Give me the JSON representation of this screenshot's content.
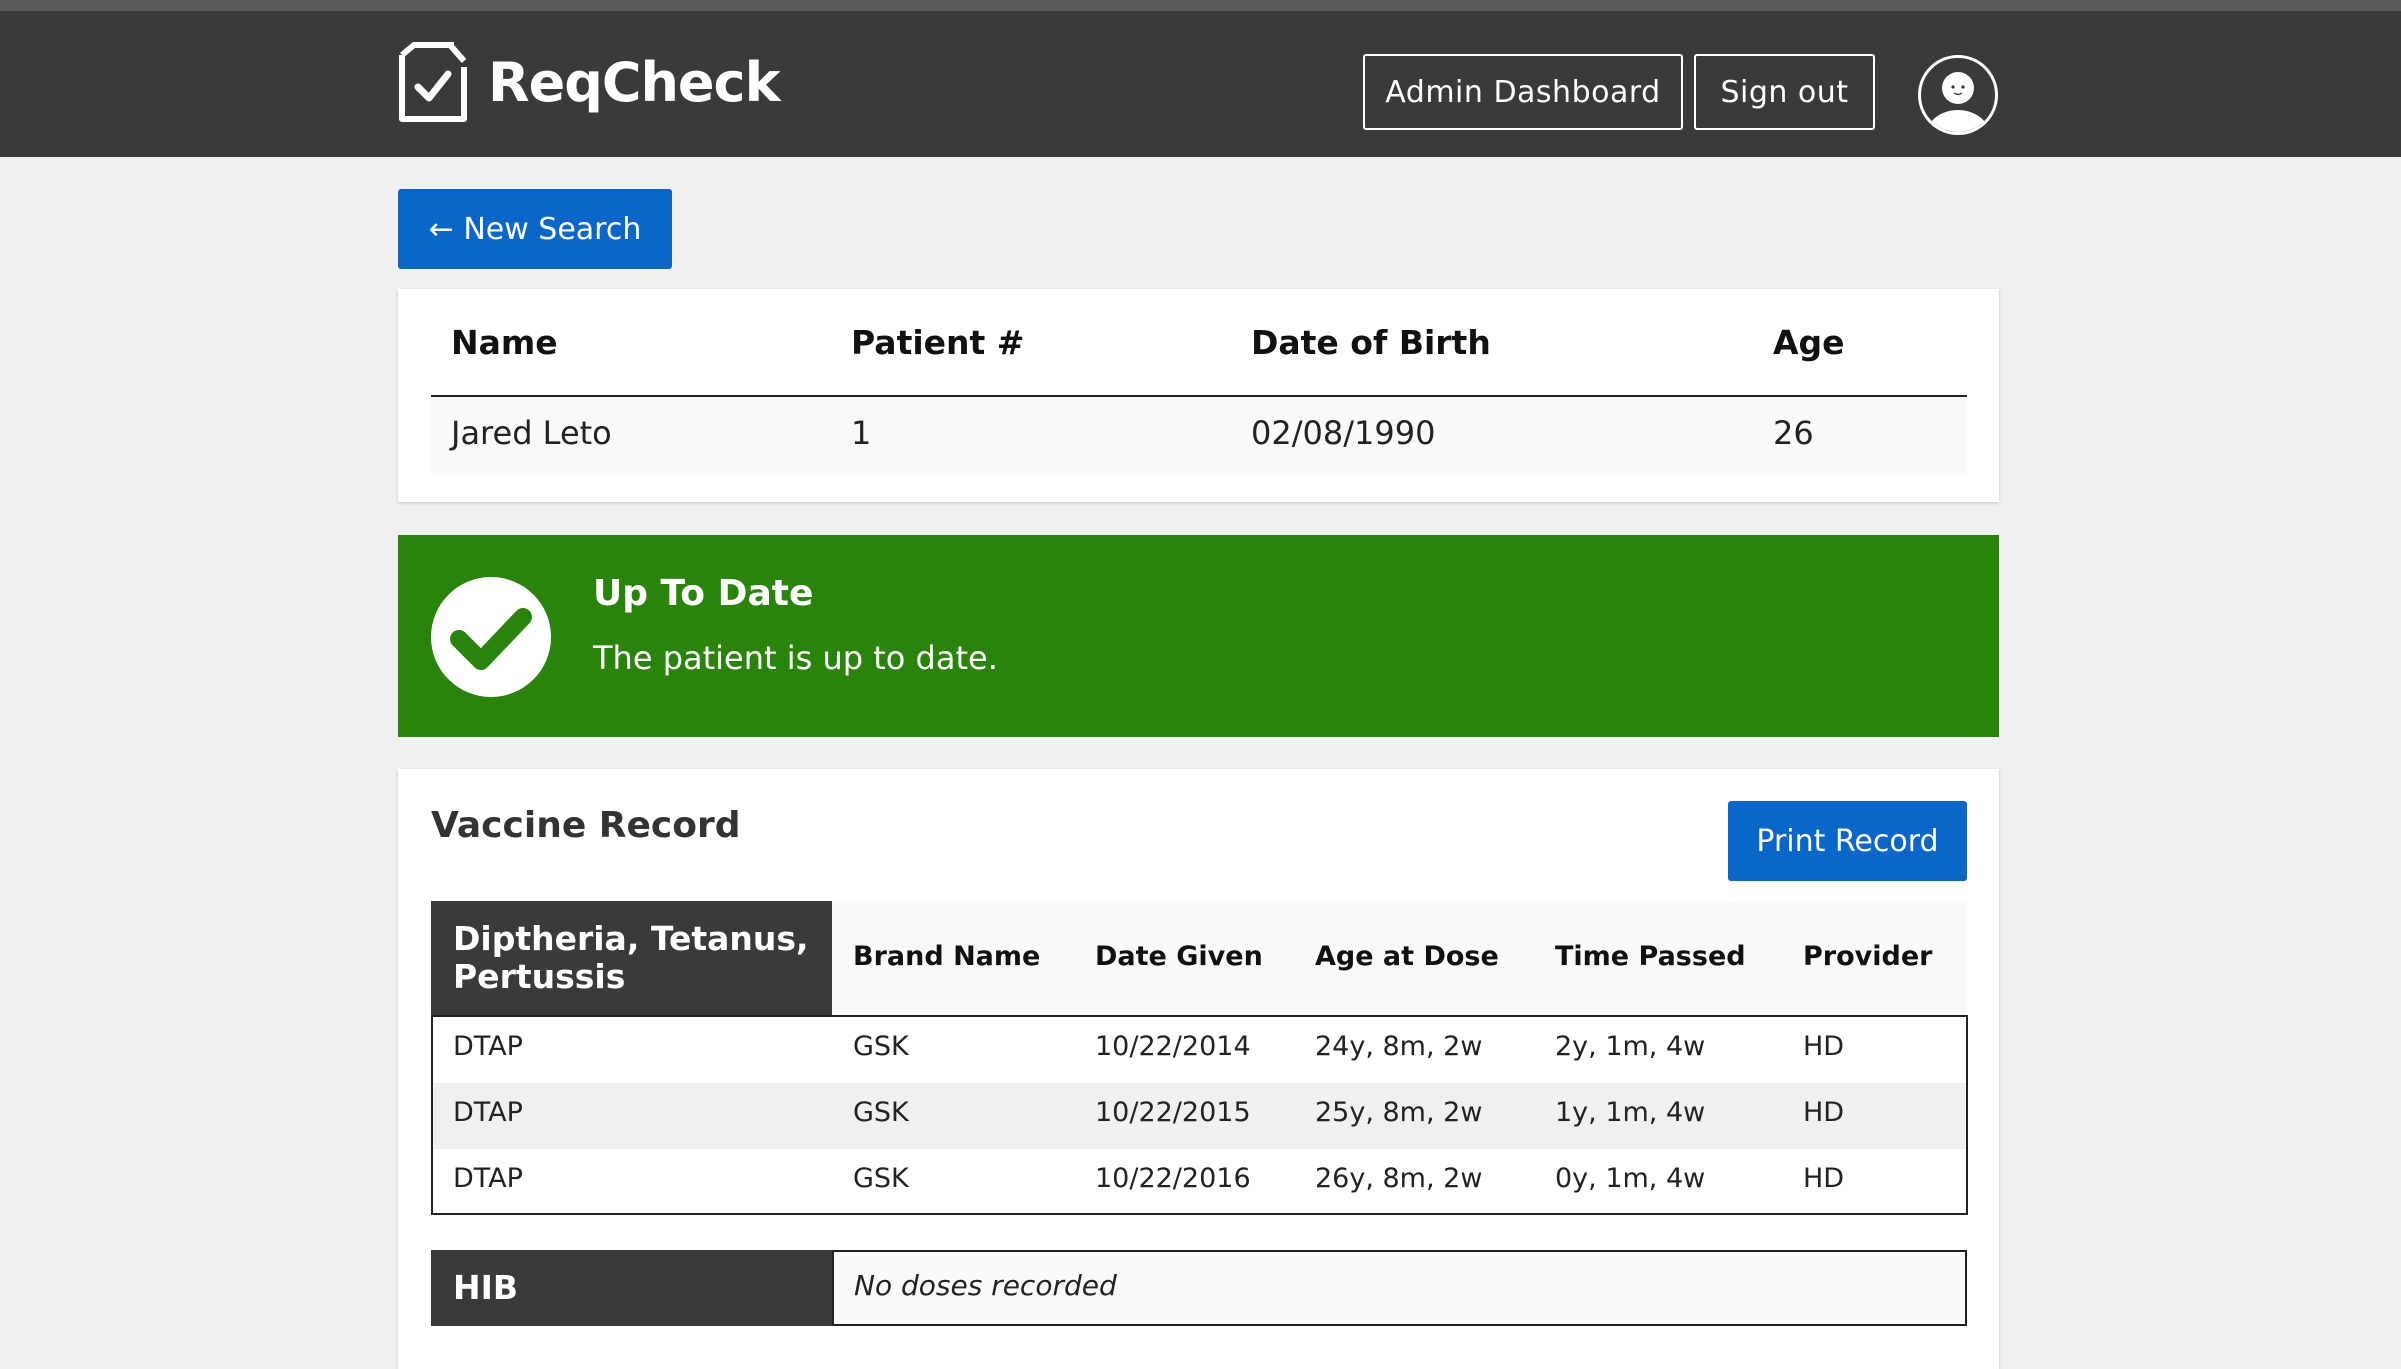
{
  "header": {
    "app_name": "ReqCheck",
    "admin_label": "Admin Dashboard",
    "signout_label": "Sign out"
  },
  "search": {
    "new_search_label": "← New Search"
  },
  "patient": {
    "headers": [
      "Name",
      "Patient #",
      "Date of Birth",
      "Age"
    ],
    "values": [
      "Jared Leto",
      "1",
      "02/08/1990",
      "26"
    ]
  },
  "status": {
    "title": "Up To Date",
    "message": "The patient is up to date.",
    "color": "#2a840b"
  },
  "vaccine_record": {
    "title": "Vaccine Record",
    "print_label": "Print Record",
    "columns": [
      "Brand Name",
      "Date Given",
      "Age at Dose",
      "Time Passed",
      "Provider"
    ],
    "groups": [
      {
        "name": "Diptheria, Tetanus, Pertussis",
        "rows": [
          [
            "DTAP",
            "GSK",
            "10/22/2014",
            "24y, 8m, 2w",
            "2y, 1m, 4w",
            "HD"
          ],
          [
            "DTAP",
            "GSK",
            "10/22/2015",
            "25y, 8m, 2w",
            "1y, 1m, 4w",
            "HD"
          ],
          [
            "DTAP",
            "GSK",
            "10/22/2016",
            "26y, 8m, 2w",
            "0y, 1m, 4w",
            "HD"
          ]
        ]
      },
      {
        "name": "HIB",
        "empty_note": "No doses recorded"
      }
    ]
  },
  "colors": {
    "header_bg": "#3a3a3c",
    "primary": "#0a66c8",
    "success": "#2a840b"
  },
  "icons": [
    "checklist-document-icon",
    "user-avatar-icon",
    "checkmark-circle-icon"
  ]
}
